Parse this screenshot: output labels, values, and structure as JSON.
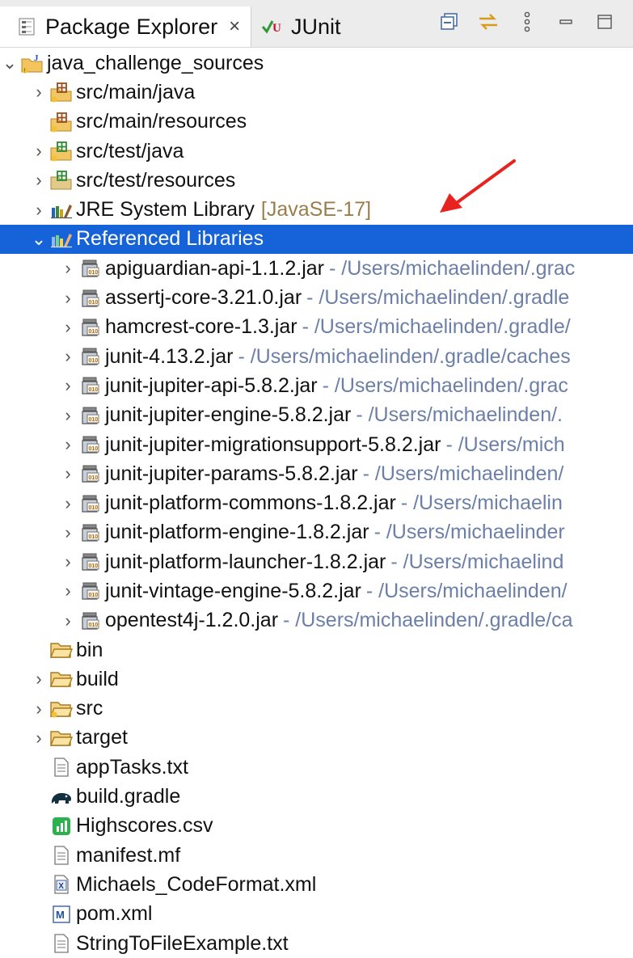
{
  "tabs": {
    "package_explorer": "Package Explorer",
    "close": "×",
    "junit": "JUnit"
  },
  "tree": {
    "project": "java_challenge_sources",
    "src_main_java": "src/main/java",
    "src_main_resources": "src/main/resources",
    "src_test_java": "src/test/java",
    "src_test_resources": "src/test/resources",
    "jre": {
      "label": "JRE System Library",
      "decoration": "[JavaSE-17]"
    },
    "referenced": "Referenced Libraries",
    "jars": [
      {
        "name": "apiguardian-api-1.1.2.jar",
        "path": "- /Users/michaelinden/.grac"
      },
      {
        "name": "assertj-core-3.21.0.jar",
        "path": "- /Users/michaelinden/.gradle"
      },
      {
        "name": "hamcrest-core-1.3.jar",
        "path": "- /Users/michaelinden/.gradle/"
      },
      {
        "name": "junit-4.13.2.jar",
        "path": "- /Users/michaelinden/.gradle/caches"
      },
      {
        "name": "junit-jupiter-api-5.8.2.jar",
        "path": "- /Users/michaelinden/.grac"
      },
      {
        "name": "junit-jupiter-engine-5.8.2.jar",
        "path": "- /Users/michaelinden/."
      },
      {
        "name": "junit-jupiter-migrationsupport-5.8.2.jar",
        "path": "- /Users/mich"
      },
      {
        "name": "junit-jupiter-params-5.8.2.jar",
        "path": "- /Users/michaelinden/"
      },
      {
        "name": "junit-platform-commons-1.8.2.jar",
        "path": "- /Users/michaelin"
      },
      {
        "name": "junit-platform-engine-1.8.2.jar",
        "path": "- /Users/michaelinder"
      },
      {
        "name": "junit-platform-launcher-1.8.2.jar",
        "path": "- /Users/michaelind"
      },
      {
        "name": "junit-vintage-engine-5.8.2.jar",
        "path": "- /Users/michaelinden/"
      },
      {
        "name": "opentest4j-1.2.0.jar",
        "path": "- /Users/michaelinden/.gradle/ca"
      }
    ],
    "folders": {
      "bin": "bin",
      "build": "build",
      "src": "src",
      "target": "target"
    },
    "files": {
      "apptasks": "appTasks.txt",
      "build_gradle": "build.gradle",
      "highscores": "Highscores.csv",
      "manifest": "manifest.mf",
      "codeformat": "Michaels_CodeFormat.xml",
      "pom": "pom.xml",
      "stringtofile": "StringToFileExample.txt"
    }
  },
  "colors": {
    "selection": "#1662d8",
    "decoration": "#9a7e4a",
    "path": "#6b7fa8",
    "annotation_arrow": "#e8231f"
  }
}
